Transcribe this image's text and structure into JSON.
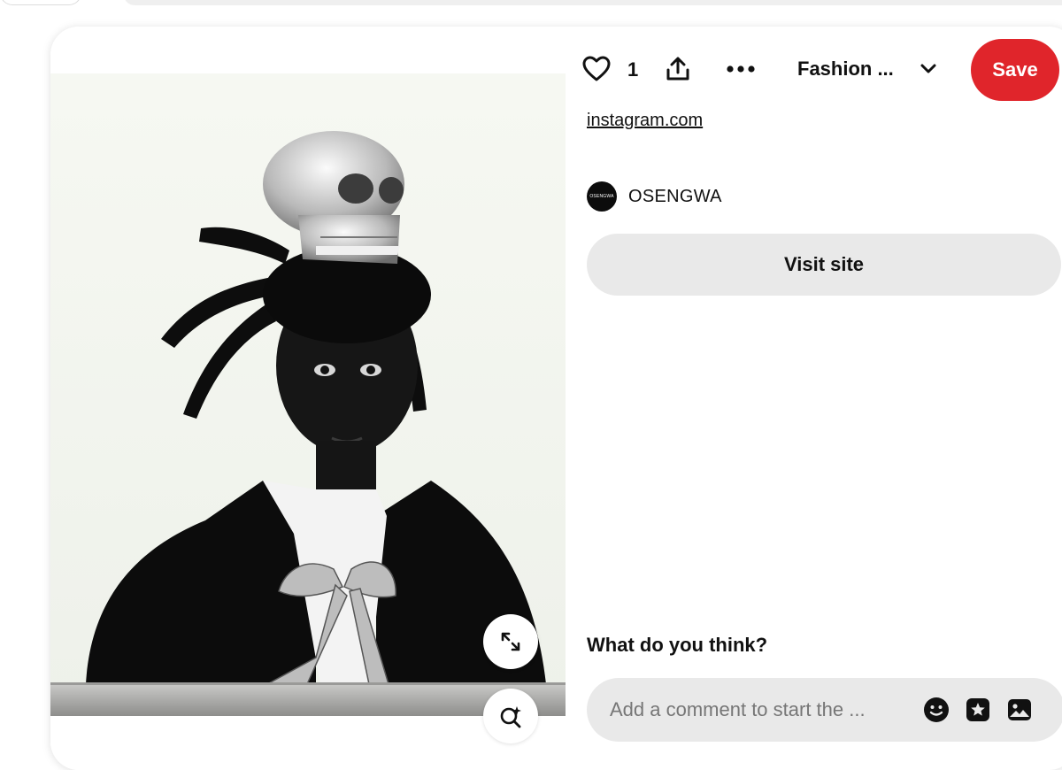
{
  "actions": {
    "like_count": "1",
    "board_name": "Fashion ...",
    "save_label": "Save"
  },
  "pin": {
    "source_link": "instagram.com",
    "author": {
      "name": "OSENGWA",
      "avatar_text": "OSENGWA"
    },
    "visit_label": "Visit site"
  },
  "comments": {
    "heading": "What do you think?",
    "placeholder": "Add a comment to start the ..."
  },
  "colors": {
    "save": "#e0252b",
    "pill_bg": "#e9e9e9"
  },
  "icons": [
    "heart-icon",
    "share-icon",
    "more-icon",
    "chevron-down-icon",
    "expand-icon",
    "visual-search-icon",
    "emoji-icon",
    "sticker-icon",
    "image-icon"
  ]
}
